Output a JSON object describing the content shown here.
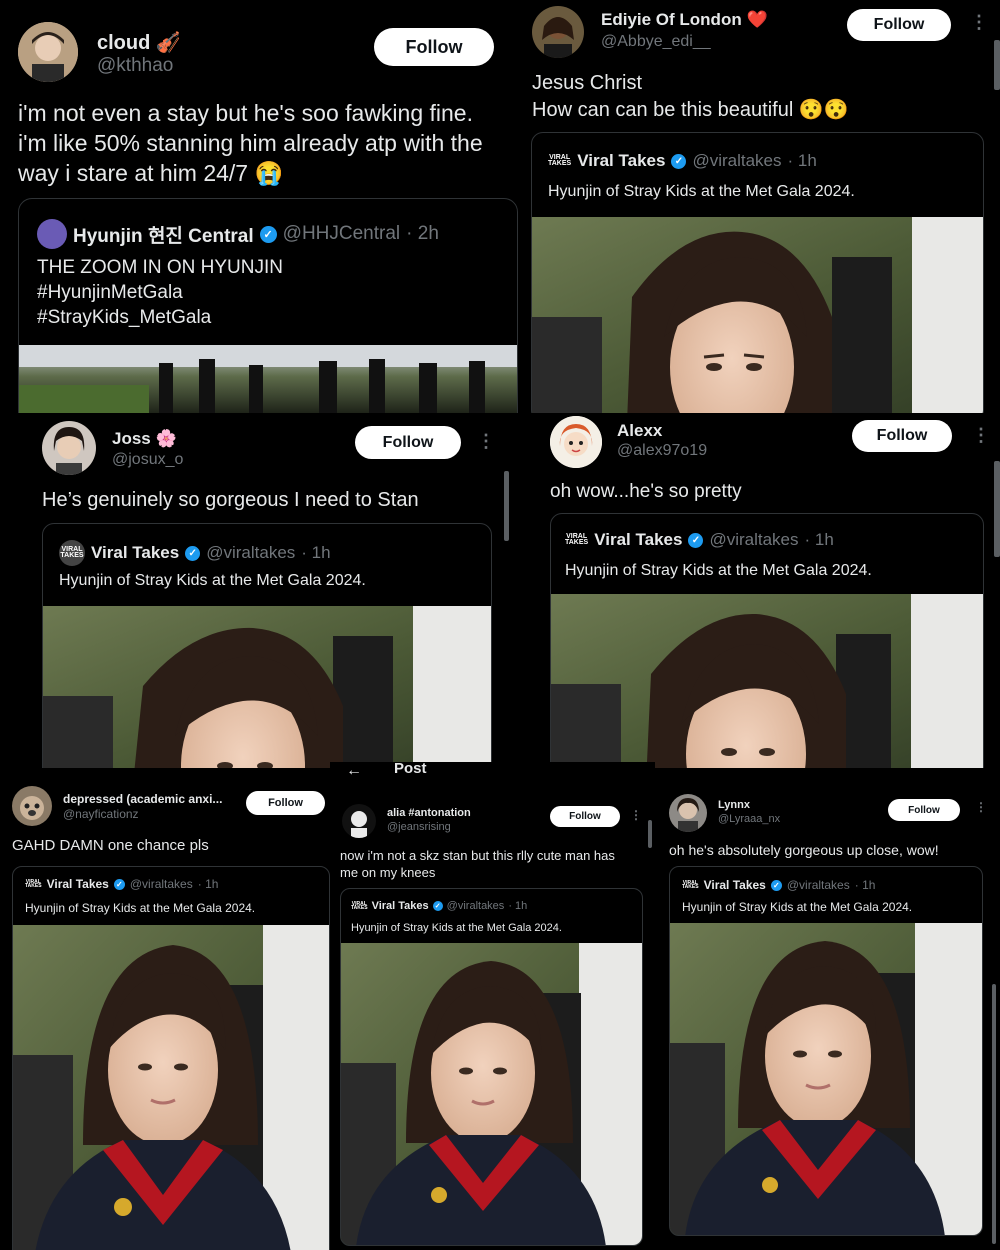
{
  "posts": [
    {
      "name": "cloud 🎻",
      "handle": "@kthhao",
      "follow": "Follow",
      "text": "i'm not even a stay but he's soo fawking fine.\ni'm like 50% stanning him already atp with the\nway i stare at him 24/7 😭",
      "quote": {
        "name": "Hyunjin 현진 Central",
        "handle": "@HHJCentral",
        "time": "· 2h",
        "text": "THE ZOOM IN ON HYUNJIN\n#HyunjinMetGala\n#StrayKids_MetGala"
      }
    },
    {
      "name": "Ediyie Of London ❤️",
      "handle": "@Abbye_edi__",
      "follow": "Follow",
      "more": "⋮",
      "text": "Jesus Christ\nHow can can be this beautiful 😯😯",
      "quote": {
        "logo": "VIRAL\nTAKES",
        "name": "Viral Takes",
        "handle": "@viraltakes",
        "time": "· 1h",
        "text": "Hyunjin of Stray Kids at the Met Gala 2024."
      }
    },
    {
      "name": "Joss 🌸",
      "handle": "@josux_o",
      "follow": "Follow",
      "more": "⋮",
      "text": "He’s genuinely so gorgeous I need to Stan",
      "quote": {
        "logo": "VIRAL\nTAKES",
        "name": "Viral Takes",
        "handle": "@viraltakes",
        "time": "· 1h",
        "text": "Hyunjin of Stray Kids at the Met Gala 2024."
      }
    },
    {
      "name": "Alexx",
      "handle": "@alex97o19",
      "follow": "Follow",
      "more": "⋮",
      "text": "oh wow...he's so pretty",
      "quote": {
        "logo": "VIRAL\nTAKES",
        "name": "Viral Takes",
        "handle": "@viraltakes",
        "time": "· 1h",
        "text": "Hyunjin of Stray Kids at the Met Gala 2024."
      }
    },
    {
      "name": "depressed (academic anxi...",
      "handle": "@nayficationz",
      "follow": "Follow",
      "text": "GAHD DAMN one chance pls",
      "quote": {
        "logo": "VIRAL\nTAKES",
        "name": "Viral Takes",
        "handle": "@viraltakes",
        "time": "· 1h",
        "text": "Hyunjin of Stray Kids at the Met Gala 2024."
      }
    },
    {
      "topbar": "Post",
      "name": "alia #antonation",
      "handle": "@jeansrising",
      "follow": "Follow",
      "more": "⋮",
      "text": "now i'm not a skz stan but this rlly cute man has\nme on my knees",
      "quote": {
        "logo": "VIRAL\nTAKES",
        "name": "Viral Takes",
        "handle": "@viraltakes",
        "time": "· 1h",
        "text": "Hyunjin of Stray Kids at the Met Gala 2024."
      }
    },
    {
      "name": "Lynnx",
      "handle": "@Lyraaa_nx",
      "follow": "Follow",
      "more": "⋮",
      "text": "oh he's absolutely gorgeous up close, wow!",
      "quote": {
        "logo": "VIRAL\nTAKES",
        "name": "Viral Takes",
        "handle": "@viraltakes",
        "time": "· 1h",
        "text": "Hyunjin of Stray Kids at the Met Gala 2024."
      }
    }
  ],
  "icons": {
    "verified": "verified-badge-icon",
    "back": "back-arrow-icon",
    "more": "more-icon"
  },
  "colors": {
    "background": "#000000",
    "text": "#e7e9ea",
    "muted": "#71767b",
    "verified": "#1d9bf0",
    "follow_bg": "#ffffff"
  }
}
